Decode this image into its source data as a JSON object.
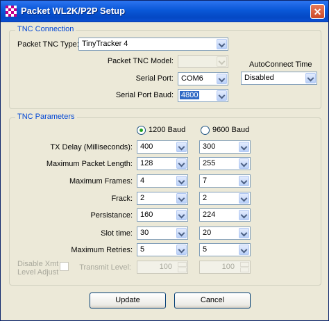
{
  "window": {
    "title": "Packet WL2K/P2P Setup",
    "close_glyph": "✕"
  },
  "tnc_connection": {
    "group_title": "TNC Connection",
    "tnc_type_label": "Packet TNC Type:",
    "tnc_type_value": "TinyTracker 4",
    "tnc_model_label": "Packet TNC Model:",
    "tnc_model_value": "",
    "serial_port_label": "Serial Port:",
    "serial_port_value": "COM6",
    "baud_label": "Serial Port Baud:",
    "baud_value": "4800",
    "autoconnect_label": "AutoConnect Time",
    "autoconnect_value": "Disabled"
  },
  "tnc_parameters": {
    "group_title": "TNC Parameters",
    "baud_1200_label": "1200 Baud",
    "baud_9600_label": "9600 Baud",
    "selected_baud": "1200 Baud",
    "rows": [
      {
        "label": "TX Delay (Milliseconds):",
        "v1200": "400",
        "v9600": "300"
      },
      {
        "label": "Maximum Packet Length:",
        "v1200": "128",
        "v9600": "255"
      },
      {
        "label": "Maximum Frames:",
        "v1200": "4",
        "v9600": "7"
      },
      {
        "label": "Frack:",
        "v1200": "2",
        "v9600": "2"
      },
      {
        "label": "Persistance:",
        "v1200": "160",
        "v9600": "224"
      },
      {
        "label": "Slot time:",
        "v1200": "30",
        "v9600": "20"
      },
      {
        "label": "Maximum Retries:",
        "v1200": "5",
        "v9600": "5"
      }
    ],
    "disable_xmt_label_line1": "Disable Xmt",
    "disable_xmt_label_line2": "Level Adjust",
    "disable_xmt_checked": false,
    "transmit_level_label": "Transmit Level:",
    "transmit_level_1200": "100",
    "transmit_level_9600": "100"
  },
  "buttons": {
    "update": "Update",
    "cancel": "Cancel"
  }
}
